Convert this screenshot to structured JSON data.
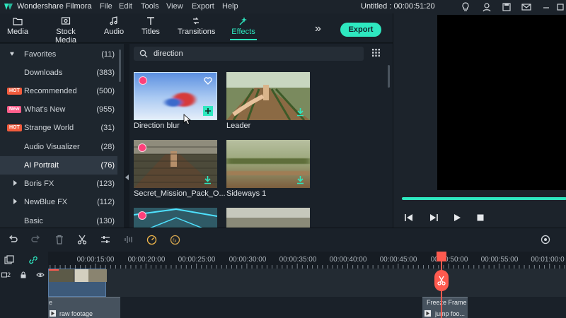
{
  "titlebar": {
    "app_name": "Wondershare Filmora",
    "menu": [
      "File",
      "Edit",
      "Tools",
      "View",
      "Export",
      "Help"
    ],
    "doc_title": "Untitled : 00:00:51:20"
  },
  "toolbar": {
    "tabs": [
      {
        "label": "Media",
        "icon": "folder-icon"
      },
      {
        "label": "Stock Media",
        "icon": "stock-media-icon"
      },
      {
        "label": "Audio",
        "icon": "music-note-icon"
      },
      {
        "label": "Titles",
        "icon": "text-t-icon"
      },
      {
        "label": "Transitions",
        "icon": "transitions-icon"
      },
      {
        "label": "Effects",
        "icon": "effects-icon",
        "active": true
      }
    ],
    "more_label": "»",
    "export_label": "Export",
    "accent_color": "#2ee8c0"
  },
  "sidebar": {
    "items": [
      {
        "label": "Favorites",
        "count": "(11)",
        "icon": "heart-icon"
      },
      {
        "label": "Downloads",
        "count": "(383)"
      },
      {
        "label": "Recommended",
        "count": "(500)",
        "badge": "HOT"
      },
      {
        "label": "What's New",
        "count": "(955)",
        "badge": "New"
      },
      {
        "label": "Strange World",
        "count": "(31)",
        "badge": "HOT"
      },
      {
        "label": "Audio Visualizer",
        "count": "(28)"
      },
      {
        "label": "AI Portrait",
        "count": "(76)",
        "active": true
      },
      {
        "label": "Boris FX",
        "count": "(123)",
        "expandable": true
      },
      {
        "label": "NewBlue FX",
        "count": "(112)",
        "expandable": true
      },
      {
        "label": "Basic",
        "count": "(130)"
      }
    ]
  },
  "search": {
    "value": "direction"
  },
  "effects": [
    {
      "label": "Direction blur",
      "premium": true,
      "favorite_icon": "heart-outline-icon",
      "add_icon": "plus-icon"
    },
    {
      "label": "Leader",
      "download_icon": "download-icon"
    },
    {
      "label": "Secret_Mission_Pack_O...",
      "premium": true,
      "download_icon": "download-icon"
    },
    {
      "label": "Sideways 1",
      "download_icon": "download-icon"
    }
  ],
  "timeline": {
    "ticks": [
      "00:00:15:00",
      "00:00:20:00",
      "00:00:25:00",
      "00:00:30:00",
      "00:00:35:00",
      "00:00:40:00",
      "00:00:45:00",
      "00:00:50:00",
      "00:00:55:00",
      "00:01:00:0"
    ],
    "track_number": "2",
    "clips": [
      {
        "label": "raw footage",
        "prefix": "e"
      },
      {
        "title": "Freeze Frame",
        "label": "jump foo..."
      }
    ],
    "playhead_color": "#ff5a4f"
  }
}
